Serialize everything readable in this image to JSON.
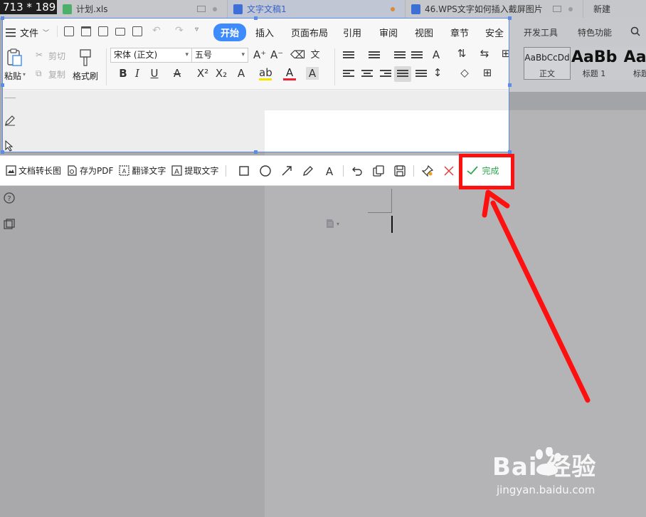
{
  "window": {
    "tabs": [
      {
        "label": "计划.xls",
        "icon": "spreadsheet-file-icon"
      },
      {
        "label": "文字文稿1",
        "icon": "word-file-icon"
      },
      {
        "label": "46.WPS文字如何插入截屏图片",
        "icon": "word-file-icon"
      },
      {
        "label": "新建"
      }
    ]
  },
  "capture": {
    "size_label": "713 * 189"
  },
  "ribbon": {
    "file_menu": "文件",
    "tabs": [
      "开始",
      "插入",
      "页面布局",
      "引用",
      "审阅",
      "视图",
      "章节",
      "安全",
      "开发工具",
      "特色功能"
    ],
    "active_tab": "开始",
    "paste_label": "粘贴",
    "cut_label": "剪切",
    "copy_label": "复制",
    "format_painter_label": "格式刷",
    "font_name": "宋体 (正文)",
    "font_size": "五号",
    "styles": [
      {
        "preview": "AaBbCcDd",
        "label": "正文"
      },
      {
        "preview": "AaBb",
        "label": "标题 1"
      },
      {
        "preview": "AaB",
        "label": "标题"
      }
    ]
  },
  "screenshot_toolbar": {
    "buttons": [
      {
        "label": "文档转长图",
        "icon": "long-image-icon"
      },
      {
        "label": "存为PDF",
        "icon": "pdf-icon"
      },
      {
        "label": "翻译文字",
        "icon": "translate-icon"
      },
      {
        "label": "提取文字",
        "icon": "extract-text-icon"
      }
    ],
    "tools": [
      "rectangle-tool-icon",
      "ellipse-tool-icon",
      "arrow-tool-icon",
      "pencil-tool-icon",
      "text-tool-icon",
      "undo-icon",
      "copy-icon",
      "save-icon",
      "pin-icon",
      "cancel-icon"
    ],
    "done_label": "完成"
  },
  "colors": {
    "accent_blue": "#3d8bfd",
    "selection_border": "#5b8de8",
    "done_green": "#2aa84a",
    "annotation_red": "#ff1010"
  },
  "watermark": {
    "brand": "Bai  经验",
    "site": "jingyan.baidu.com"
  }
}
